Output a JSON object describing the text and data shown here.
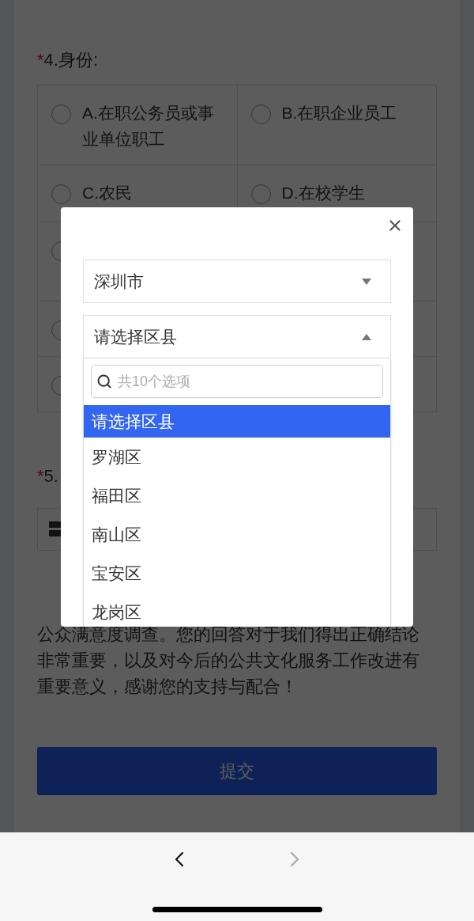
{
  "question_4": {
    "required_mark": "*",
    "title": "4.身份:",
    "rows": [
      {
        "cells": [
          {
            "kind": "radio",
            "label": "A.在职公务员或事业单位职工",
            "selected": false
          },
          {
            "kind": "radio",
            "label": "B.在职企业员工",
            "selected": false
          }
        ]
      },
      {
        "cells": [
          {
            "kind": "radio",
            "label": "C.农民",
            "selected": false
          },
          {
            "kind": "radio",
            "label": "D.在校学生",
            "selected": false
          }
        ]
      },
      {
        "cells": [
          {
            "kind": "radio",
            "selected": false
          }
        ]
      },
      {
        "cells": [
          {
            "kind": "radio",
            "selected": false
          }
        ]
      },
      {
        "cells": [
          {
            "kind": "radio",
            "selected": false
          }
        ]
      }
    ]
  },
  "question_5": {
    "required_mark": "*",
    "title": "5."
  },
  "paragraph": "公众满意度调查。您的回答对于我们得出正确结论非常重要，以及对今后的公共文化服务工作改进有重要意义，感谢您的支持与配合！",
  "submit_button": "提交",
  "modal": {
    "city_select": {
      "value": "深圳市",
      "expanded": false
    },
    "district_select": {
      "value": "请选择区县",
      "expanded": true
    },
    "search": {
      "placeholder": "共10个选项"
    },
    "options": [
      {
        "label": "请选择区县",
        "selected": true
      },
      {
        "label": "罗湖区",
        "selected": false
      },
      {
        "label": "福田区",
        "selected": false
      },
      {
        "label": "南山区",
        "selected": false
      },
      {
        "label": "宝安区",
        "selected": false
      },
      {
        "label": "龙岗区",
        "selected": false
      }
    ]
  },
  "browser_bar": {
    "back": {
      "disabled": false
    },
    "forward": {
      "disabled": true
    }
  }
}
